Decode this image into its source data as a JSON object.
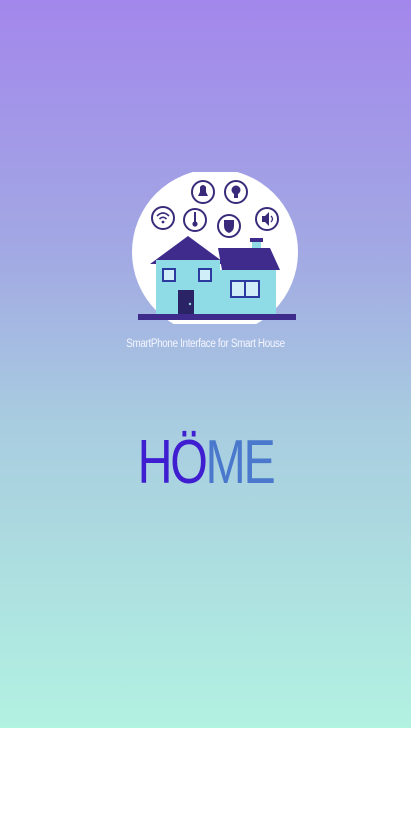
{
  "splash": {
    "tagline": "SmartPhone Interface for Smart House",
    "brand_part1": "HÖ",
    "brand_part2": "ME",
    "logo_alt": "smart-house-logo"
  },
  "colors": {
    "gradient_top": "#a387ec",
    "gradient_bottom": "#b2f2e1",
    "brand_primary": "#3e1ed0",
    "brand_secondary": "#4a78cc",
    "roof": "#3f2b8c",
    "house_wall": "#8fdbe6"
  }
}
